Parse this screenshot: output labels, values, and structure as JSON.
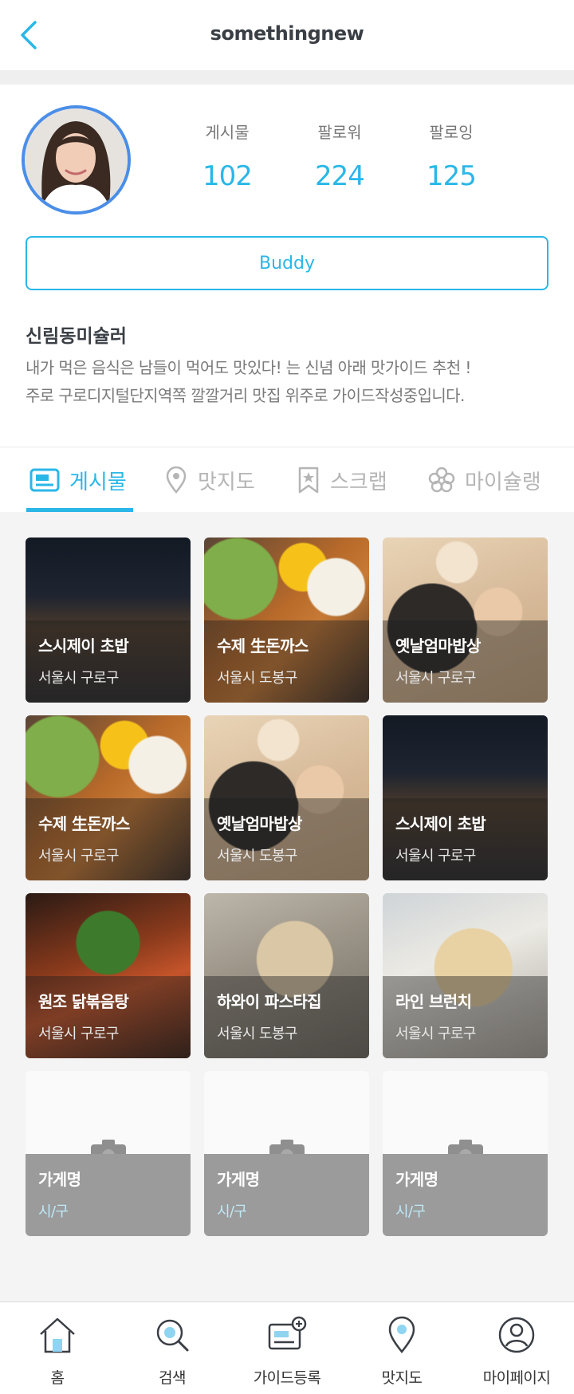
{
  "header": {
    "title": "somethingnew",
    "back_icon": "chevron-left-icon"
  },
  "profile": {
    "stats": [
      {
        "label": "게시물",
        "value": "102"
      },
      {
        "label": "팔로워",
        "value": "224"
      },
      {
        "label": "팔로잉",
        "value": "125"
      }
    ],
    "buddy_label": "Buddy",
    "nickname": "신림동미슐러",
    "bio_line1": "내가 먹은 음식은 남들이 먹어도 맛있다! 는 신념 아래 맛가이드 추천 !",
    "bio_line2": "주로 구로디지털단지역쪽 깔깔거리 맛집 위주로 가이드작성중입니다."
  },
  "tabs": [
    {
      "label": "게시물",
      "icon": "post-card-icon",
      "active": true
    },
    {
      "label": "맛지도",
      "icon": "map-pin-icon"
    },
    {
      "label": "스크랩",
      "icon": "bookmark-star-icon"
    },
    {
      "label": "마이슐랭",
      "icon": "flower-icon"
    }
  ],
  "cards": [
    {
      "name": "스시제이 초밥",
      "location": "서울시 구로구"
    },
    {
      "name": "수제 生돈까스",
      "location": "서울시 도봉구"
    },
    {
      "name": "옛날엄마밥상",
      "location": "서울시 구로구"
    },
    {
      "name": "수제 生돈까스",
      "location": "서울시 구로구"
    },
    {
      "name": "옛날엄마밥상",
      "location": "서울시 도봉구"
    },
    {
      "name": "스시제이 초밥",
      "location": "서울시 구로구"
    },
    {
      "name": "원조 닭볶음탕",
      "location": "서울시 구로구"
    },
    {
      "name": "하와이 파스타집",
      "location": "서울시 도봉구"
    },
    {
      "name": "라인 브런치",
      "location": "서울시 구로구"
    },
    {
      "name": "가게명",
      "location": "시/구"
    },
    {
      "name": "가게명",
      "location": "시/구"
    },
    {
      "name": "가게명",
      "location": "시/구"
    }
  ],
  "bottom_nav": [
    {
      "label": "홈",
      "icon": "home-icon"
    },
    {
      "label": "검색",
      "icon": "search-icon"
    },
    {
      "label": "가이드등록",
      "icon": "guide-add-icon"
    },
    {
      "label": "맛지도",
      "icon": "map-pin-icon"
    },
    {
      "label": "마이페이지",
      "icon": "user-icon"
    }
  ],
  "colors": {
    "accent": "#2ab7e8",
    "avatar_ring": "#4a8ee8",
    "placeholder_overlay": "#9b9b9b"
  }
}
